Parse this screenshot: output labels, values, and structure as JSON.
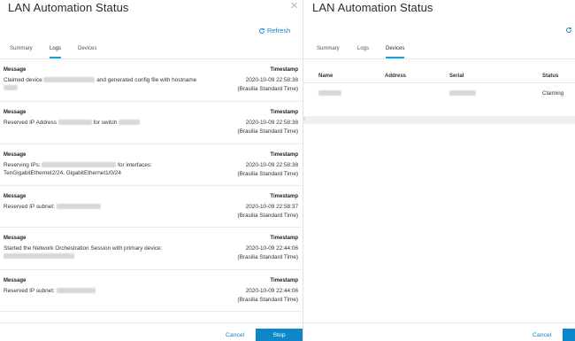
{
  "left": {
    "title": "LAN Automation Status",
    "refresh_label": "Refresh",
    "tabs": [
      {
        "label": "Summary"
      },
      {
        "label": "Logs"
      },
      {
        "label": "Devices"
      }
    ],
    "column_headers": {
      "message": "Message",
      "timestamp": "Timestamp"
    },
    "logs": [
      {
        "line1_pre": "Claimed device",
        "line1_post": "and generated config file with hostname",
        "timestamp": "2020-10-09 22:58:38",
        "timezone": "(Brasilia Standard Time)"
      },
      {
        "line1_pre": "Reserved IP Address",
        "line1_post": "for switch",
        "timestamp": "2020-10-09 22:58:38",
        "timezone": "(Brasilia Standard Time)"
      },
      {
        "line1_pre": "Reserving IPs:",
        "line1_post": "for interfaces:",
        "line2": "TenGigabitEthernet2/24, GigabitEthernet1/0/24",
        "timestamp": "2020-10-09 22:58:38",
        "timezone": "(Brasilia Standard Time)"
      },
      {
        "line1_pre": "Reserved IP subnet:",
        "timestamp": "2020-10-09 22:58:37",
        "timezone": "(Brasilia Standard Time)"
      },
      {
        "line1_pre": "Started the Network Orchestration Session with primary device:",
        "timestamp": "2020-10-09 22:44:06",
        "timezone": "(Brasilia Standard Time)"
      },
      {
        "line1_pre": "Reserved IP subnet:",
        "timestamp": "2020-10-09 22:44:06",
        "timezone": "(Brasilia Standard Time)"
      }
    ],
    "footer": {
      "cancel_label": "Cancel",
      "stop_label": "Stop"
    }
  },
  "right": {
    "title": "LAN Automation Status",
    "tabs": [
      {
        "label": "Summary"
      },
      {
        "label": "Logs"
      },
      {
        "label": "Devices"
      }
    ],
    "table_headers": {
      "name": "Name",
      "address": "Address",
      "serial": "Serial",
      "status": "Status"
    },
    "rows": [
      {
        "status": "Claiming"
      }
    ],
    "footer": {
      "cancel_label": "Cancel"
    }
  },
  "colors": {
    "accent": "#0d87c9",
    "tab_underline": "#1aa2d6"
  },
  "icons": {
    "refresh": "refresh-icon",
    "close": "close-icon",
    "scroll_left": "chevron-left-icon"
  }
}
